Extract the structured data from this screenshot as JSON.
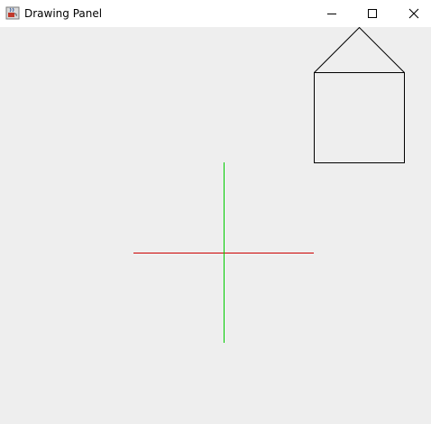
{
  "window": {
    "title": "Drawing Panel",
    "app_icon": "java-cup-icon"
  },
  "titlebar_controls": {
    "minimize_icon": "minimize-icon",
    "maximize_icon": "maximize-icon",
    "close_icon": "close-icon"
  },
  "canvas": {
    "background_color": "#eeeeee",
    "shapes": [
      {
        "kind": "horizontal-line",
        "color": "#cc0000"
      },
      {
        "kind": "vertical-line",
        "color": "#00cc00"
      },
      {
        "kind": "house-roof",
        "color": "#000000"
      },
      {
        "kind": "house-body-square",
        "color": "#000000"
      }
    ]
  }
}
